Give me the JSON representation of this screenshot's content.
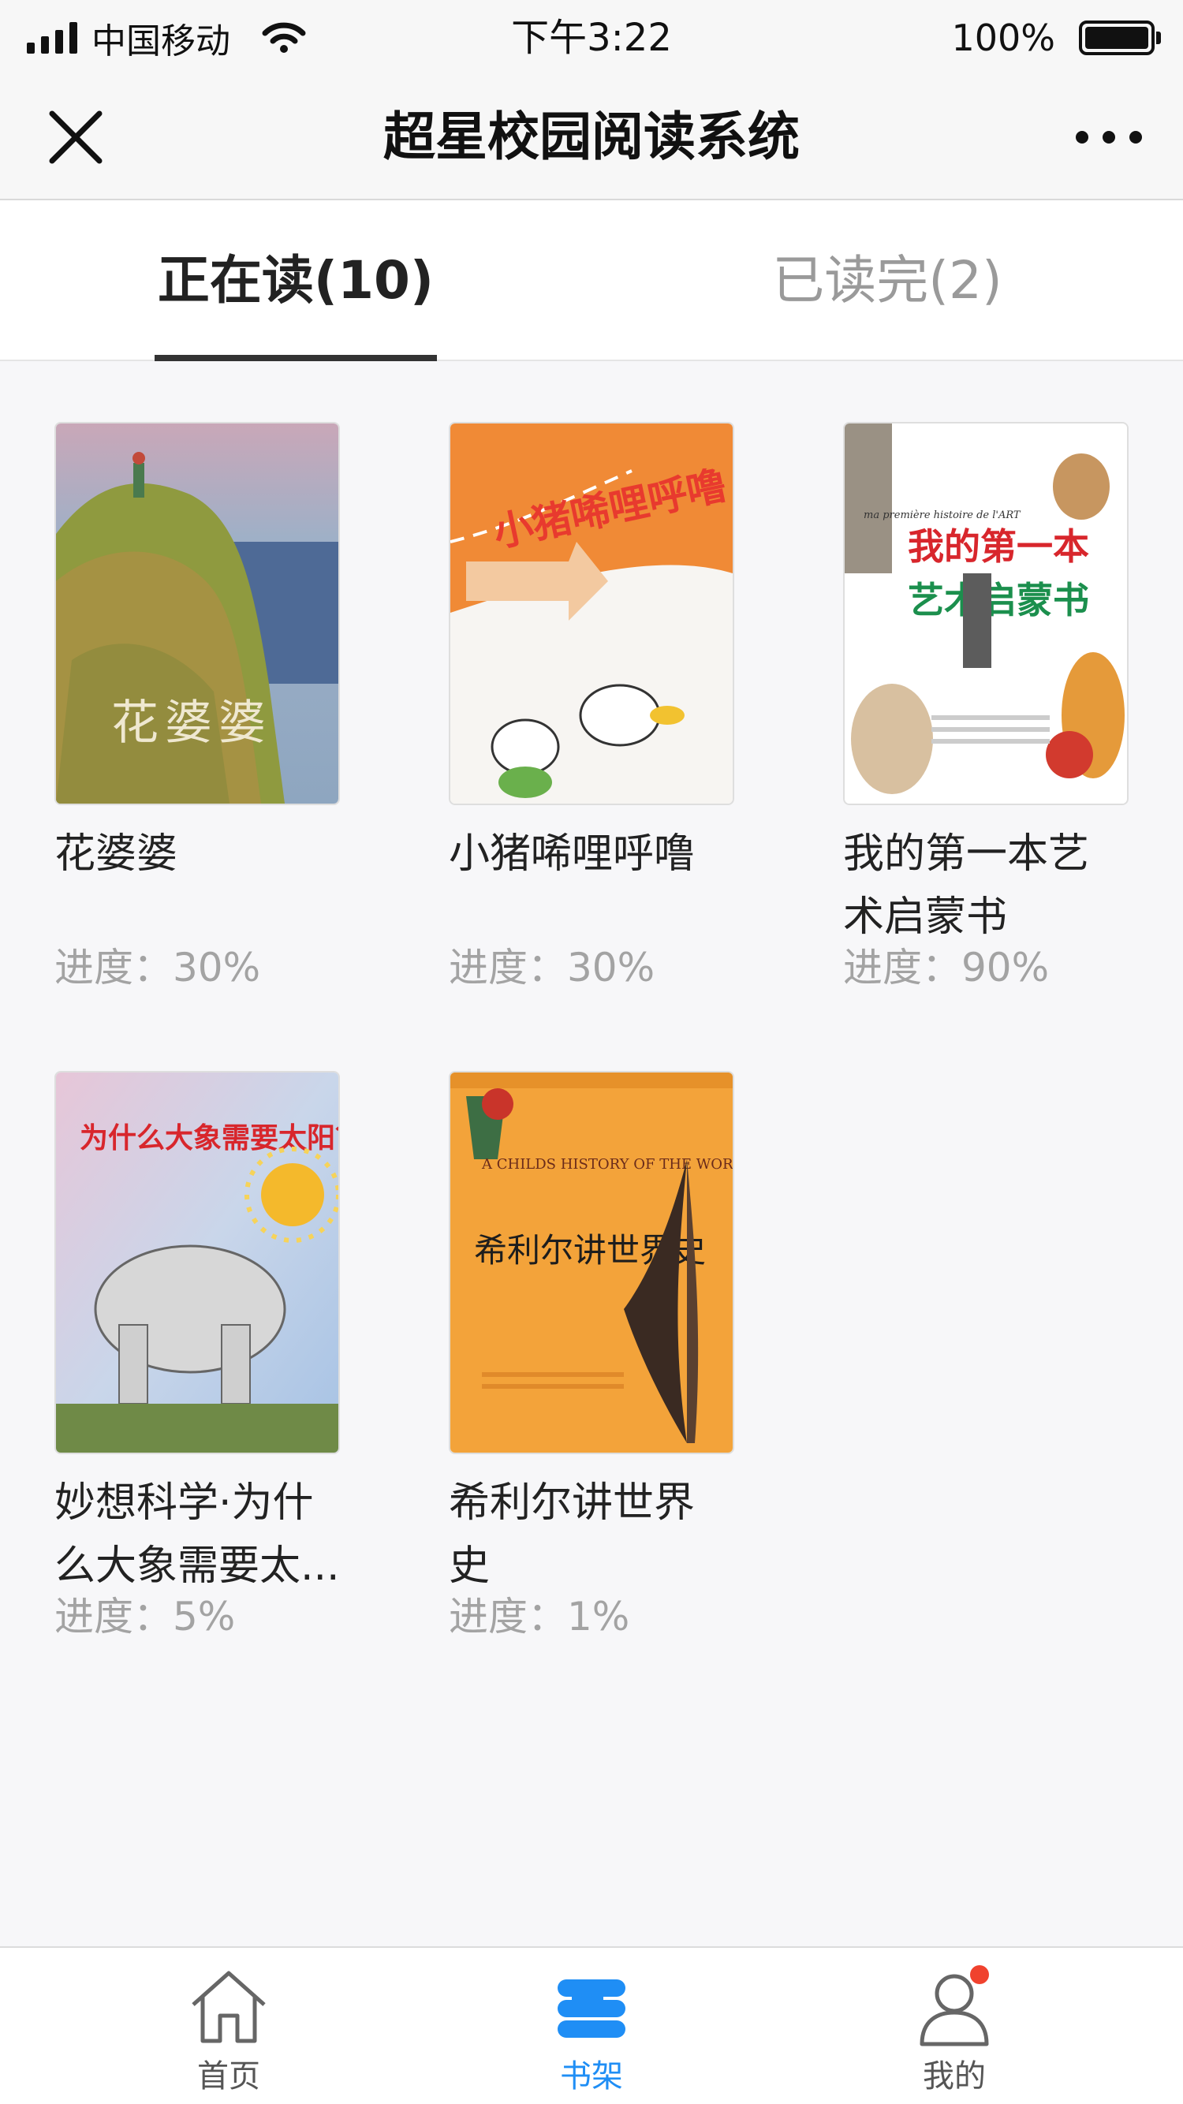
{
  "status_bar": {
    "carrier": "中国移动",
    "time": "下午3:22",
    "battery": "100%"
  },
  "nav": {
    "title": "超星校园阅读系统",
    "close_icon": "close-icon",
    "more_icon": "more-icon"
  },
  "tabs": {
    "reading": "正在读(10)",
    "finished": "已读完(2)",
    "active": "reading"
  },
  "books": [
    {
      "title": "花婆婆",
      "progress": "进度：30%",
      "cover_text": "花婆婆"
    },
    {
      "title": "小猪唏哩呼噜",
      "progress": "进度：30%",
      "cover_text": "小猪唏哩呼噜"
    },
    {
      "title": "我的第一本艺术启蒙书",
      "progress": "进度：90%",
      "cover_text": "我的第一本艺术启蒙书",
      "cover_subtitle": "ma première histoire de l'ART"
    },
    {
      "title": "妙想科学·为什么大象需要太...",
      "progress": "进度：5%",
      "cover_text": "为什么大象需要太阳？"
    },
    {
      "title": "希利尔讲世界史",
      "progress": "进度：1%",
      "cover_text": "希利尔讲世界史",
      "cover_subtitle": "A CHILDS HISTORY OF THE WORLD"
    }
  ],
  "tabbar": {
    "home": "首页",
    "shelf": "书架",
    "mine": "我的",
    "active": "shelf",
    "accent": "#1f8ef5",
    "badge_color": "#f0422e"
  }
}
